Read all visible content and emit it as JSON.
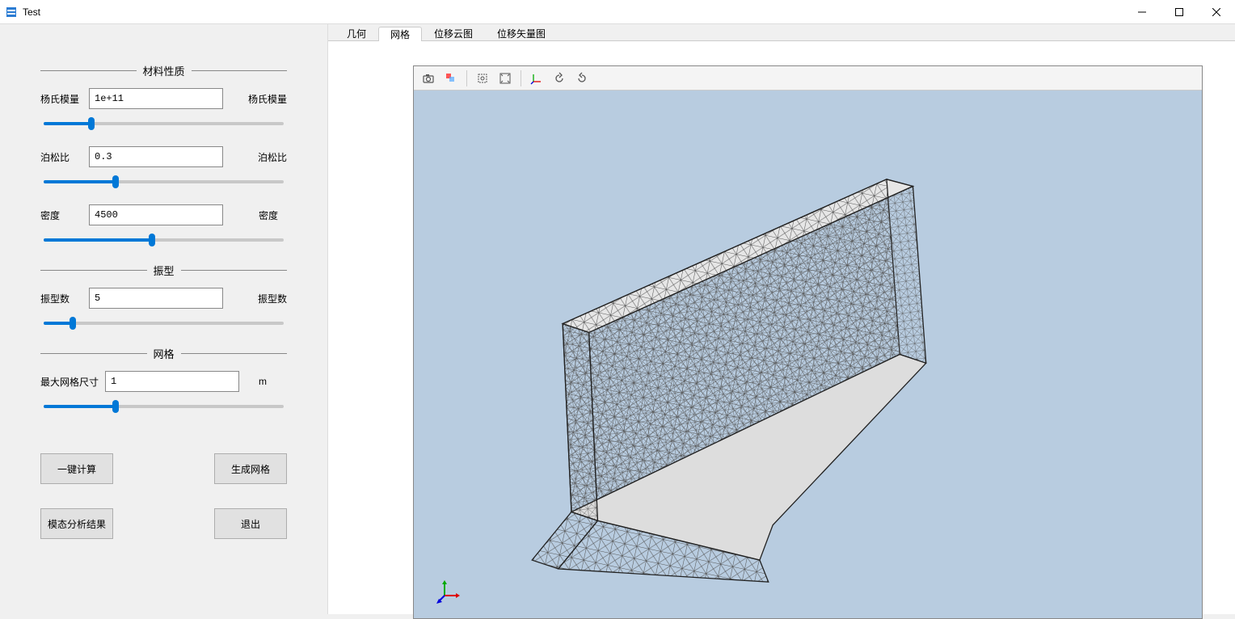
{
  "window": {
    "title": "Test"
  },
  "tabs": {
    "items": [
      {
        "label": "几何"
      },
      {
        "label": "网格",
        "active": true
      },
      {
        "label": "位移云图"
      },
      {
        "label": "位移矢量图"
      }
    ]
  },
  "panel": {
    "material_section": "材料性质",
    "youngs_modulus": {
      "label": "杨氏模量",
      "value": "1e+11",
      "suffix": "杨氏模量",
      "slider_pct": 20
    },
    "poisson_ratio": {
      "label": "泊松比",
      "value": "0.3",
      "suffix": "泊松比",
      "slider_pct": 30
    },
    "density": {
      "label": "密度",
      "value": "4500",
      "suffix": "密度",
      "slider_pct": 45
    },
    "mode_section": "振型",
    "mode_count": {
      "label": "振型数",
      "value": "5",
      "suffix": "振型数",
      "slider_pct": 12
    },
    "mesh_section": "网格",
    "max_mesh_size": {
      "label": "最大网格尺寸",
      "value": "1",
      "suffix": "m",
      "slider_pct": 30
    }
  },
  "buttons": {
    "calc": "一键计算",
    "gen_mesh": "生成网格",
    "modal_results": "模态分析结果",
    "exit": "退出"
  },
  "toolbar_icons": [
    "camera-icon",
    "transparency-icon",
    "zoom-area-icon",
    "zoom-extents-icon",
    "axes-icon",
    "rotate-left-icon",
    "rotate-right-icon"
  ]
}
